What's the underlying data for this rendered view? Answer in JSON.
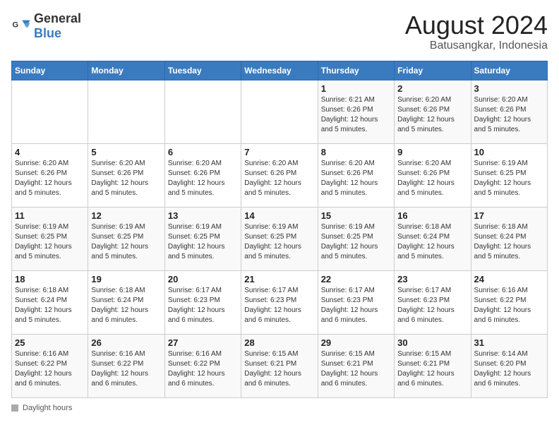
{
  "header": {
    "logo_general": "General",
    "logo_blue": "Blue",
    "month_year": "August 2024",
    "location": "Batusangkar, Indonesia"
  },
  "days_of_week": [
    "Sunday",
    "Monday",
    "Tuesday",
    "Wednesday",
    "Thursday",
    "Friday",
    "Saturday"
  ],
  "footer": {
    "label": "Daylight hours"
  },
  "weeks": [
    [
      {
        "num": "",
        "info": ""
      },
      {
        "num": "",
        "info": ""
      },
      {
        "num": "",
        "info": ""
      },
      {
        "num": "",
        "info": ""
      },
      {
        "num": "1",
        "info": "Sunrise: 6:21 AM\nSunset: 6:26 PM\nDaylight: 12 hours\nand 5 minutes."
      },
      {
        "num": "2",
        "info": "Sunrise: 6:20 AM\nSunset: 6:26 PM\nDaylight: 12 hours\nand 5 minutes."
      },
      {
        "num": "3",
        "info": "Sunrise: 6:20 AM\nSunset: 6:26 PM\nDaylight: 12 hours\nand 5 minutes."
      }
    ],
    [
      {
        "num": "4",
        "info": "Sunrise: 6:20 AM\nSunset: 6:26 PM\nDaylight: 12 hours\nand 5 minutes."
      },
      {
        "num": "5",
        "info": "Sunrise: 6:20 AM\nSunset: 6:26 PM\nDaylight: 12 hours\nand 5 minutes."
      },
      {
        "num": "6",
        "info": "Sunrise: 6:20 AM\nSunset: 6:26 PM\nDaylight: 12 hours\nand 5 minutes."
      },
      {
        "num": "7",
        "info": "Sunrise: 6:20 AM\nSunset: 6:26 PM\nDaylight: 12 hours\nand 5 minutes."
      },
      {
        "num": "8",
        "info": "Sunrise: 6:20 AM\nSunset: 6:26 PM\nDaylight: 12 hours\nand 5 minutes."
      },
      {
        "num": "9",
        "info": "Sunrise: 6:20 AM\nSunset: 6:26 PM\nDaylight: 12 hours\nand 5 minutes."
      },
      {
        "num": "10",
        "info": "Sunrise: 6:19 AM\nSunset: 6:25 PM\nDaylight: 12 hours\nand 5 minutes."
      }
    ],
    [
      {
        "num": "11",
        "info": "Sunrise: 6:19 AM\nSunset: 6:25 PM\nDaylight: 12 hours\nand 5 minutes."
      },
      {
        "num": "12",
        "info": "Sunrise: 6:19 AM\nSunset: 6:25 PM\nDaylight: 12 hours\nand 5 minutes."
      },
      {
        "num": "13",
        "info": "Sunrise: 6:19 AM\nSunset: 6:25 PM\nDaylight: 12 hours\nand 5 minutes."
      },
      {
        "num": "14",
        "info": "Sunrise: 6:19 AM\nSunset: 6:25 PM\nDaylight: 12 hours\nand 5 minutes."
      },
      {
        "num": "15",
        "info": "Sunrise: 6:19 AM\nSunset: 6:25 PM\nDaylight: 12 hours\nand 5 minutes."
      },
      {
        "num": "16",
        "info": "Sunrise: 6:18 AM\nSunset: 6:24 PM\nDaylight: 12 hours\nand 5 minutes."
      },
      {
        "num": "17",
        "info": "Sunrise: 6:18 AM\nSunset: 6:24 PM\nDaylight: 12 hours\nand 5 minutes."
      }
    ],
    [
      {
        "num": "18",
        "info": "Sunrise: 6:18 AM\nSunset: 6:24 PM\nDaylight: 12 hours\nand 5 minutes."
      },
      {
        "num": "19",
        "info": "Sunrise: 6:18 AM\nSunset: 6:24 PM\nDaylight: 12 hours\nand 6 minutes."
      },
      {
        "num": "20",
        "info": "Sunrise: 6:17 AM\nSunset: 6:23 PM\nDaylight: 12 hours\nand 6 minutes."
      },
      {
        "num": "21",
        "info": "Sunrise: 6:17 AM\nSunset: 6:23 PM\nDaylight: 12 hours\nand 6 minutes."
      },
      {
        "num": "22",
        "info": "Sunrise: 6:17 AM\nSunset: 6:23 PM\nDaylight: 12 hours\nand 6 minutes."
      },
      {
        "num": "23",
        "info": "Sunrise: 6:17 AM\nSunset: 6:23 PM\nDaylight: 12 hours\nand 6 minutes."
      },
      {
        "num": "24",
        "info": "Sunrise: 6:16 AM\nSunset: 6:22 PM\nDaylight: 12 hours\nand 6 minutes."
      }
    ],
    [
      {
        "num": "25",
        "info": "Sunrise: 6:16 AM\nSunset: 6:22 PM\nDaylight: 12 hours\nand 6 minutes."
      },
      {
        "num": "26",
        "info": "Sunrise: 6:16 AM\nSunset: 6:22 PM\nDaylight: 12 hours\nand 6 minutes."
      },
      {
        "num": "27",
        "info": "Sunrise: 6:16 AM\nSunset: 6:22 PM\nDaylight: 12 hours\nand 6 minutes."
      },
      {
        "num": "28",
        "info": "Sunrise: 6:15 AM\nSunset: 6:21 PM\nDaylight: 12 hours\nand 6 minutes."
      },
      {
        "num": "29",
        "info": "Sunrise: 6:15 AM\nSunset: 6:21 PM\nDaylight: 12 hours\nand 6 minutes."
      },
      {
        "num": "30",
        "info": "Sunrise: 6:15 AM\nSunset: 6:21 PM\nDaylight: 12 hours\nand 6 minutes."
      },
      {
        "num": "31",
        "info": "Sunrise: 6:14 AM\nSunset: 6:20 PM\nDaylight: 12 hours\nand 6 minutes."
      }
    ]
  ]
}
